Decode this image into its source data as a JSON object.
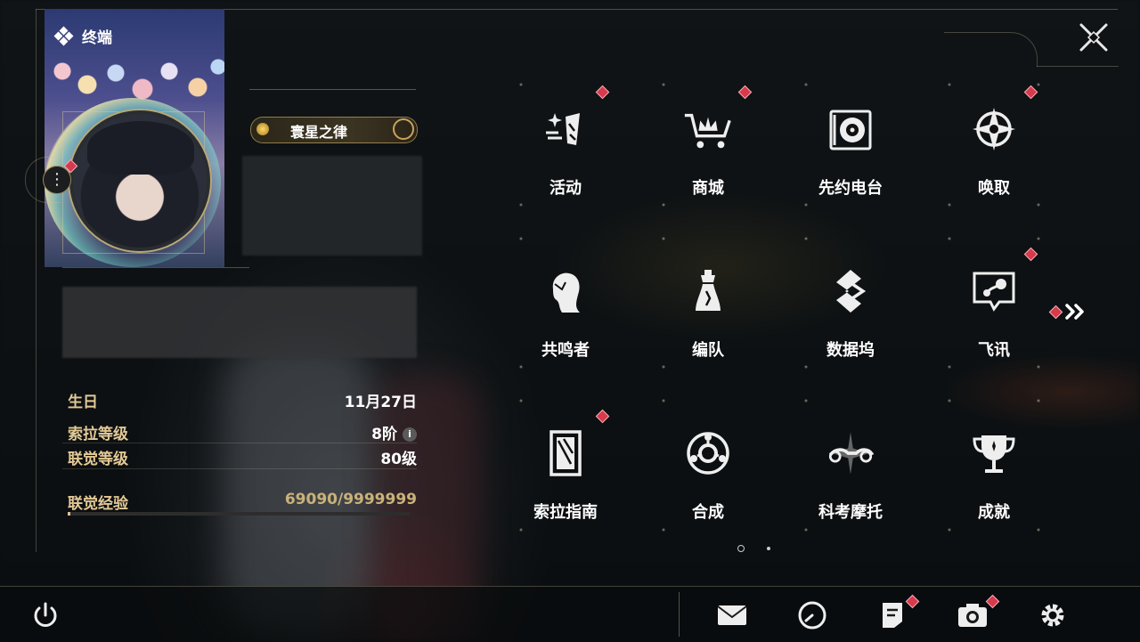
{
  "header": {
    "title": "终端",
    "close_icon": "close-x-icon"
  },
  "profile": {
    "title_badge": "寰星之律",
    "fields": [
      {
        "key": "生日",
        "value": "11月27日"
      },
      {
        "key": "索拉等级",
        "value": "8阶"
      },
      {
        "key": "联觉等级",
        "value": "80级"
      }
    ],
    "exp_label": "联觉经验",
    "exp_value": "69090/9999999",
    "exp_fraction": 0.0069,
    "info_icon": "i"
  },
  "menu": [
    {
      "label": "活动",
      "icon": "activity-sparkle-icon",
      "badge": true
    },
    {
      "label": "商城",
      "icon": "shop-cart-icon",
      "badge": true
    },
    {
      "label": "先约电台",
      "icon": "radio-record-icon",
      "badge": false
    },
    {
      "label": "唤取",
      "icon": "summon-compass-icon",
      "badge": true
    },
    {
      "label": "共鸣者",
      "icon": "resonator-head-icon",
      "badge": false
    },
    {
      "label": "编队",
      "icon": "team-chess-icon",
      "badge": false
    },
    {
      "label": "数据坞",
      "icon": "data-bank-icon",
      "badge": false
    },
    {
      "label": "飞讯",
      "icon": "message-bubble-icon",
      "badge": true
    },
    {
      "label": "索拉指南",
      "icon": "guide-book-icon",
      "badge": true
    },
    {
      "label": "合成",
      "icon": "synthesis-ring-icon",
      "badge": false
    },
    {
      "label": "科考摩托",
      "icon": "motorbike-icon",
      "badge": false
    },
    {
      "label": "成就",
      "icon": "achievement-trophy-icon",
      "badge": false
    }
  ],
  "pager": {
    "pages": 2,
    "current": 1
  },
  "bottom_bar": {
    "icons": [
      "power-icon",
      "mail-icon",
      "clock-icon",
      "notes-icon",
      "camera-icon",
      "settings-gear-icon"
    ]
  },
  "colors": {
    "accent_gold": "#e3c995",
    "badge_red": "#d63a4c"
  }
}
